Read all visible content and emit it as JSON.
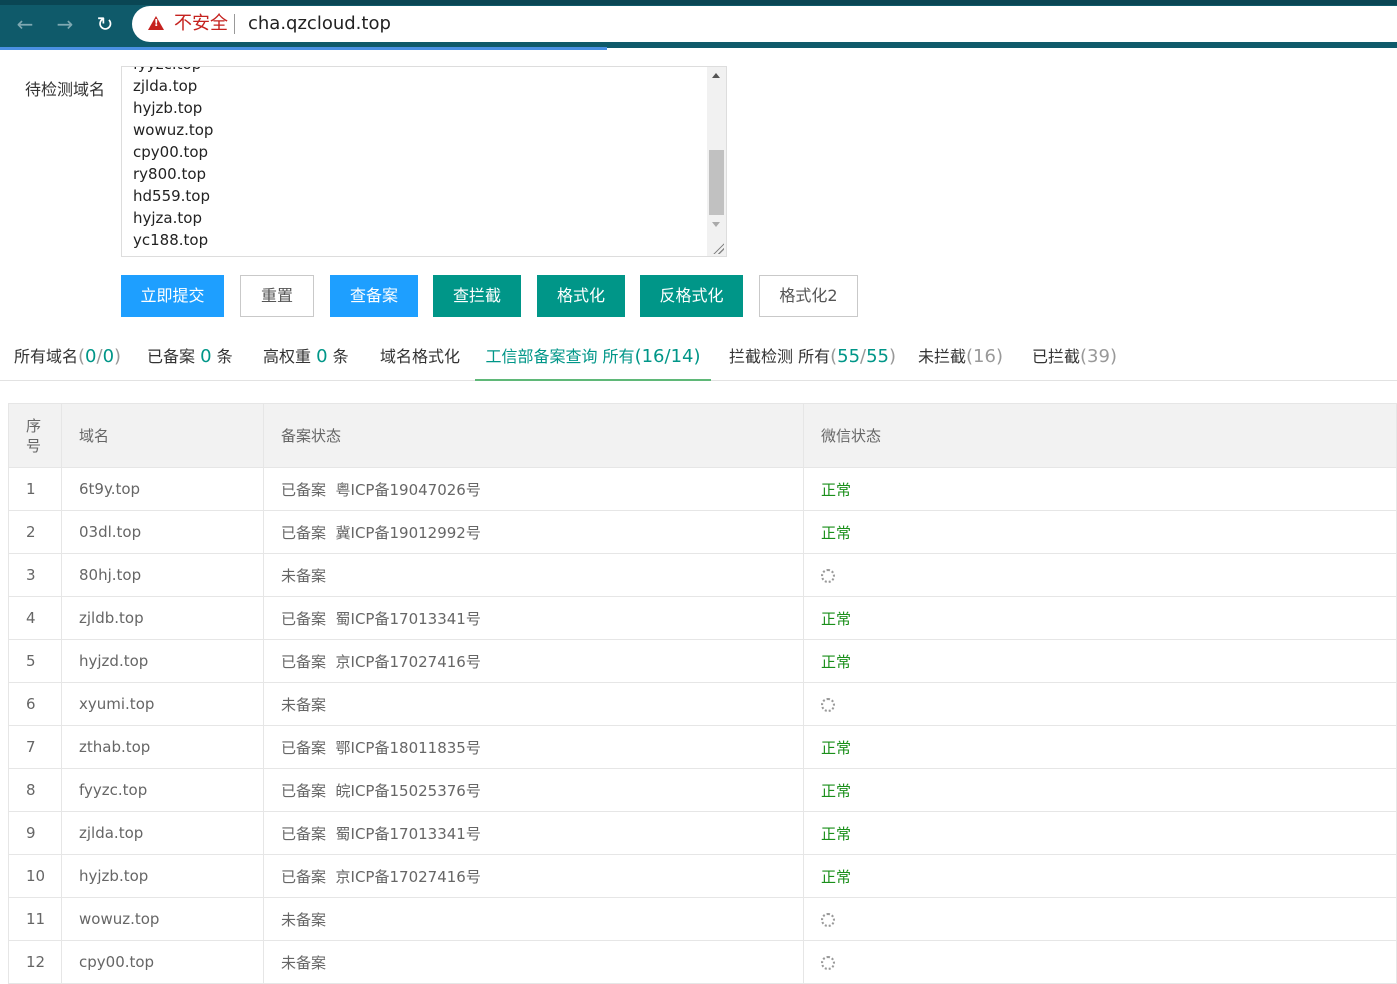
{
  "browser": {
    "insecure_label": "不安全",
    "url": "cha.qzcloud.top"
  },
  "form": {
    "label": "待检测域名",
    "domains_visible": [
      "fyyzc.top",
      "zjlda.top",
      "hyjzb.top",
      "wowuz.top",
      "cpy00.top",
      "ry800.top",
      "hd559.top",
      "hyjza.top",
      "yc188.top"
    ]
  },
  "buttons": {
    "submit": "立即提交",
    "reset": "重置",
    "check_icp": "查备案",
    "check_block": "查拦截",
    "format": "格式化",
    "unformat": "反格式化",
    "format2": "格式化2"
  },
  "tabs": {
    "all": {
      "label": "所有域名",
      "open": "(",
      "a": "0",
      "slash": "/",
      "b": "0",
      "close": ")"
    },
    "registered": {
      "label": "已备案 ",
      "count": "0",
      "suffix": " 条"
    },
    "high_weight": {
      "label": "高权重 ",
      "count": "0",
      "suffix": " 条"
    },
    "domain_format": {
      "label": "域名格式化"
    },
    "miit": {
      "label": "工信部备案查询 所有",
      "open": "(",
      "a": "16",
      "slash": "/",
      "b": "14",
      "close": ")"
    },
    "block_check": {
      "label": "拦截检测 所有",
      "open": "(",
      "a": "55",
      "slash": "/",
      "b": "55",
      "close": ")"
    },
    "unblocked": {
      "label": "未拦截",
      "open": "(",
      "count": "16",
      "close": ")"
    },
    "blocked": {
      "label": "已拦截",
      "open": "(",
      "count": "39",
      "close": ")"
    }
  },
  "table": {
    "headers": {
      "index_line1": "序",
      "index_line2": "号",
      "domain": "域名",
      "icp_status": "备案状态",
      "wechat_status": "微信状态"
    },
    "rows": [
      {
        "index": "1",
        "domain": "6t9y.top",
        "icp": "已备案  粤ICP备19047026号",
        "wechat": "正常",
        "ok": true
      },
      {
        "index": "2",
        "domain": "03dl.top",
        "icp": "已备案  冀ICP备19012992号",
        "wechat": "正常",
        "ok": true
      },
      {
        "index": "3",
        "domain": "80hj.top",
        "icp": "未备案",
        "wechat": "",
        "ok": false
      },
      {
        "index": "4",
        "domain": "zjldb.top",
        "icp": "已备案  蜀ICP备17013341号",
        "wechat": "正常",
        "ok": true
      },
      {
        "index": "5",
        "domain": "hyjzd.top",
        "icp": "已备案  京ICP备17027416号",
        "wechat": "正常",
        "ok": true
      },
      {
        "index": "6",
        "domain": "xyumi.top",
        "icp": "未备案",
        "wechat": "",
        "ok": false
      },
      {
        "index": "7",
        "domain": "zthab.top",
        "icp": "已备案  鄂ICP备18011835号",
        "wechat": "正常",
        "ok": true
      },
      {
        "index": "8",
        "domain": "fyyzc.top",
        "icp": "已备案  皖ICP备15025376号",
        "wechat": "正常",
        "ok": true
      },
      {
        "index": "9",
        "domain": "zjlda.top",
        "icp": "已备案  蜀ICP备17013341号",
        "wechat": "正常",
        "ok": true
      },
      {
        "index": "10",
        "domain": "hyjzb.top",
        "icp": "已备案  京ICP备17027416号",
        "wechat": "正常",
        "ok": true
      },
      {
        "index": "11",
        "domain": "wowuz.top",
        "icp": "未备案",
        "wechat": "",
        "ok": false
      },
      {
        "index": "12",
        "domain": "cpy00.top",
        "icp": "未备案",
        "wechat": "",
        "ok": false
      }
    ]
  },
  "colors": {
    "blue": "#1e9fff",
    "green": "#009688",
    "ok_text": "#1a8f1a",
    "browser_bar": "#0f5a6a"
  }
}
